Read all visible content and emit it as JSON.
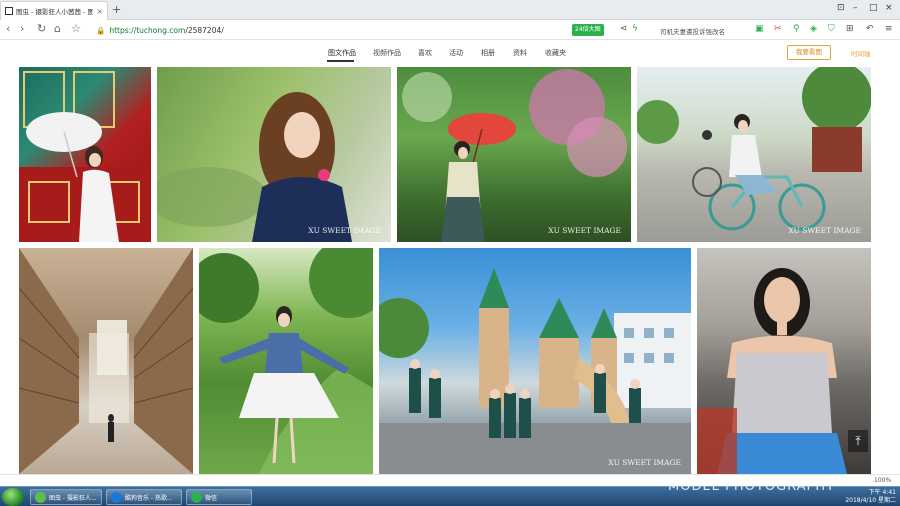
{
  "browser": {
    "tab_title": "图虫 - 摄影狂人小茜茜 - 图虫网",
    "url_scheme": "https://",
    "url_host": "tuchong.com",
    "url_path": "/2587204/",
    "ext_badge": "24倍大图",
    "news_text": "司机夫妻遭投诉强改名"
  },
  "site_nav": {
    "items": [
      "图文作品",
      "视频作品",
      "喜欢",
      "活动",
      "相册",
      "资料",
      "收藏夹"
    ],
    "active": "图文作品",
    "follow_label": "我要看图",
    "timeline_label": "时间轴"
  },
  "photos": {
    "row1": [
      {
        "name": "woman-umbrella-red-door",
        "watermark": ""
      },
      {
        "name": "long-hair-girl-garden",
        "watermark": "XU SWEET IMAGE"
      },
      {
        "name": "girl-red-umbrella-blossom",
        "watermark": "XU SWEET IMAGE"
      },
      {
        "name": "girl-bicycle-street",
        "watermark": "XU SWEET IMAGE"
      }
    ],
    "row2": [
      {
        "name": "warehouse-aisle",
        "watermark": ""
      },
      {
        "name": "denim-jacket-girl-grass",
        "watermark": ""
      },
      {
        "name": "students-playground-castle",
        "watermark": "XU SWEET IMAGE"
      },
      {
        "name": "model-silver-top",
        "watermark": ""
      }
    ]
  },
  "status": {
    "zoom": "100%"
  },
  "taskbar": {
    "items": [
      "图虫 - 摄影狂人...",
      "酷狗音乐 - 热歌...",
      "微信"
    ],
    "time": "下午 4:41",
    "date": "2018/4/10 星期二",
    "overlay_text": "MODEL PHOTOGRAPHY"
  },
  "icons": {
    "back": "back-arrow-icon",
    "forward": "forward-arrow-icon",
    "refresh": "refresh-icon",
    "home": "home-icon",
    "star": "star-icon",
    "lock": "lock-icon",
    "menu": "menu-icon"
  },
  "colors": {
    "accent": "#e6a23c",
    "secure": "#0b7a2a",
    "badge": "#2bb24c"
  }
}
